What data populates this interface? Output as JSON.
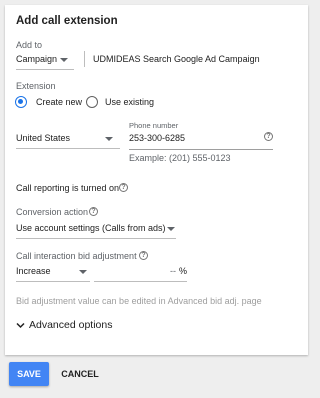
{
  "dialog": {
    "title": "Add call extension",
    "add_to_label": "Add to",
    "add_to_value": "Campaign",
    "campaign_name": "UDMIDEAS Search Google Ad Campaign"
  },
  "extension": {
    "label": "Extension",
    "option_create": "Create new",
    "option_existing": "Use existing",
    "selected": "Create new"
  },
  "phone": {
    "country": "United States",
    "number_label": "Phone number",
    "number_value": "253-300-6285",
    "example": "Example: (201) 555-0123"
  },
  "call_reporting": {
    "text": "Call reporting is turned on"
  },
  "conversion": {
    "label": "Conversion action",
    "value": "Use account settings (Calls from ads)"
  },
  "bid": {
    "label": "Call interaction bid adjustment",
    "direction": "Increase",
    "value_placeholder": "--",
    "unit": "%",
    "note": "Bid adjustment value can be edited in Advanced bid adj. page"
  },
  "advanced": {
    "label": "Advanced options"
  },
  "actions": {
    "save": "SAVE",
    "cancel": "CANCEL"
  }
}
